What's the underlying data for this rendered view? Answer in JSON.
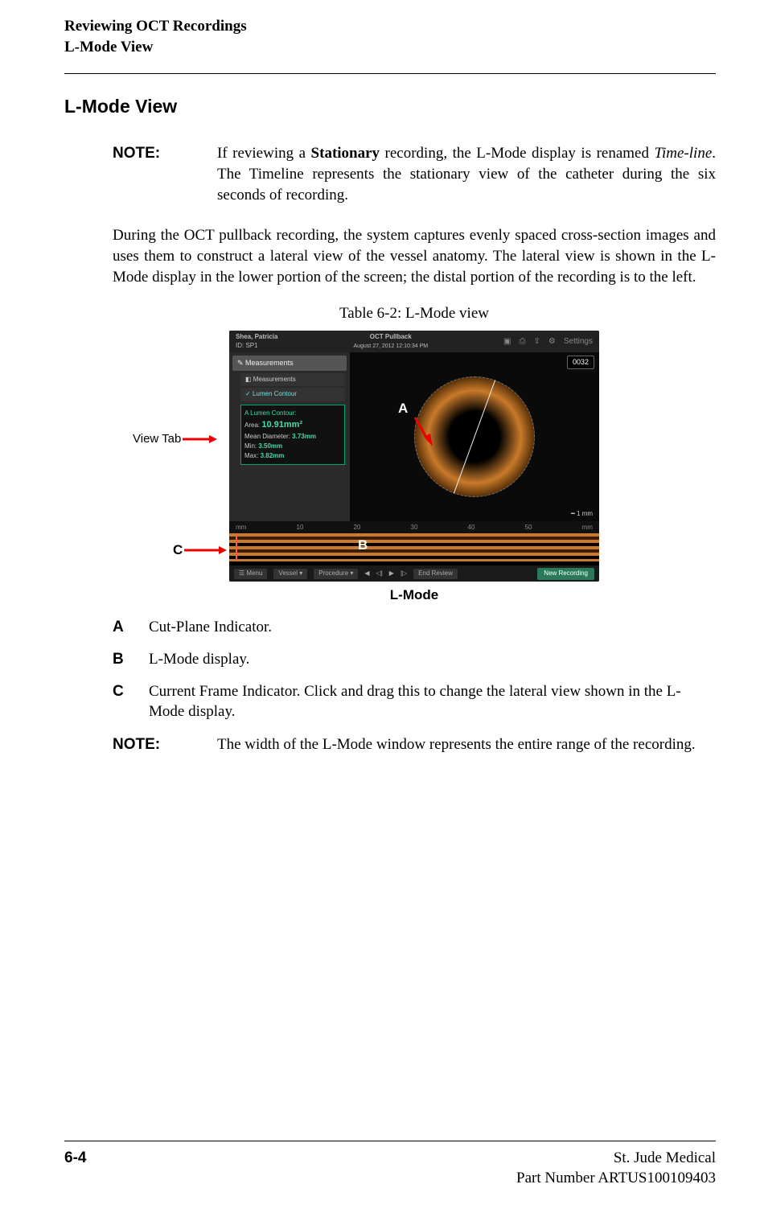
{
  "header": {
    "line1": "Reviewing OCT Recordings",
    "line2": "L-Mode View"
  },
  "section_heading": "L-Mode View",
  "note1": {
    "label": "NOTE:",
    "text_parts": {
      "pre": "If reviewing a ",
      "bold": "Stationary",
      "mid": " recording, the L-Mode display is renamed ",
      "italic": "Time-line",
      "post": ". The Timeline represents the stationary view of the catheter during the six seconds of recording."
    }
  },
  "body_para": "During the OCT pullback recording, the system captures evenly spaced cross-section images and uses them to construct a lateral view of the vessel anatomy. The lateral view is shown in the L-Mode display in the lower portion of the screen; the distal portion of the recording is to the left.",
  "table_caption": "Table 6-2:  L-Mode view",
  "annotations": {
    "view_tab": "View Tab",
    "A": "A",
    "B": "B",
    "C": "C"
  },
  "screenshot": {
    "patient_name": "Shea, Patricia",
    "patient_id": "ID: SP1",
    "title_center": "OCT Pullback",
    "date_line": "August 27, 2012 12:10:34 PM",
    "settings": "Settings",
    "tab_measurements": "Measurements",
    "subtab_measurements": "Measurements",
    "subtab_lumen": "Lumen Contour",
    "measure_title": "A Lumen Contour:",
    "measure_rows": [
      {
        "label": "Area:",
        "value": "10.91mm²"
      },
      {
        "label": "Mean Diameter:",
        "value": "3.73mm"
      },
      {
        "label": "Min:",
        "value": "3.50mm"
      },
      {
        "label": "Max:",
        "value": "3.82mm"
      }
    ],
    "frame_badge": "0032",
    "scale": "1 mm",
    "ruler_ticks": [
      "mm",
      "10",
      "20",
      "30",
      "40",
      "50",
      "mm"
    ],
    "footer_menu": "Menu",
    "footer_vessel": "Vessel ▾",
    "footer_proc": "Procedure ▾",
    "footer_end": "End Review",
    "footer_new": "New Recording"
  },
  "figure_caption": "L-Mode",
  "callouts": [
    {
      "letter": "A",
      "text": "Cut-Plane Indicator."
    },
    {
      "letter": "B",
      "text": "L-Mode display."
    },
    {
      "letter": "C",
      "text": "Current Frame Indicator. Click and drag this to change the lateral view shown in the L-Mode display."
    }
  ],
  "note2": {
    "label": "NOTE:",
    "text": "The width of the L-Mode window represents the entire range of the recording."
  },
  "footer": {
    "company": "St. Jude Medical",
    "page": "6-4",
    "part": "Part Number ARTUS100109403"
  }
}
